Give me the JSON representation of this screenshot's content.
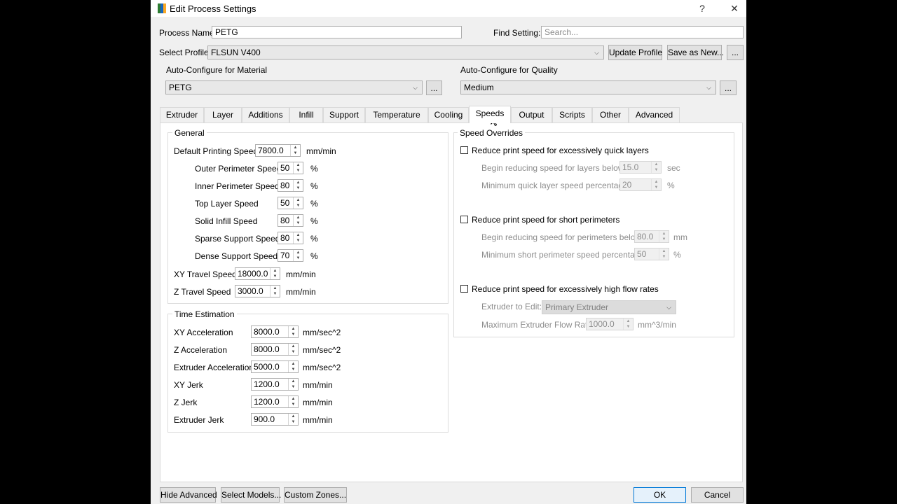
{
  "window": {
    "title": "Edit Process Settings",
    "help": "?",
    "close": "✕"
  },
  "top": {
    "process_name_label": "Process Name",
    "process_name_value": "PETG",
    "find_setting_label": "Find Setting:",
    "find_setting_placeholder": "Search...",
    "select_profile_label": "Select Profile",
    "select_profile_value": "FLSUN V400",
    "update_profile": "Update Profile",
    "save_as_new": "Save as New...",
    "more": "..."
  },
  "autoconfig": {
    "material_label": "Auto-Configure for Material",
    "material_value": "PETG",
    "quality_label": "Auto-Configure for Quality",
    "quality_value": "Medium",
    "more": "..."
  },
  "tabs": [
    "Extruder",
    "Layer",
    "Additions",
    "Infill",
    "Support",
    "Temperature",
    "Cooling",
    "Speeds",
    "Output",
    "Scripts",
    "Other",
    "Advanced"
  ],
  "active_tab": "Speeds",
  "general": {
    "title": "General",
    "default_label": "Default Printing Speed",
    "default_value": "7800.0",
    "default_unit": "mm/min",
    "outer_label": "Outer Perimeter Speed",
    "outer_value": "50",
    "inner_label": "Inner Perimeter Speed",
    "inner_value": "80",
    "top_label": "Top Layer Speed",
    "top_value": "50",
    "solid_label": "Solid Infill Speed",
    "solid_value": "80",
    "sparse_label": "Sparse Support Speed",
    "sparse_value": "80",
    "dense_label": "Dense Support Speed",
    "dense_value": "70",
    "pct": "%",
    "xy_travel_label": "XY Travel Speed",
    "xy_travel_value": "18000.0",
    "z_travel_label": "Z Travel Speed",
    "z_travel_value": "3000.0",
    "mmmin": "mm/min"
  },
  "time": {
    "title": "Time Estimation",
    "xy_acc_label": "XY Acceleration",
    "xy_acc_value": "8000.0",
    "z_acc_label": "Z Acceleration",
    "z_acc_value": "8000.0",
    "ext_acc_label": "Extruder Acceleration",
    "ext_acc_value": "5000.0",
    "acc_unit": "mm/sec^2",
    "xy_jerk_label": "XY Jerk",
    "xy_jerk_value": "1200.0",
    "z_jerk_label": "Z Jerk",
    "z_jerk_value": "1200.0",
    "ext_jerk_label": "Extruder Jerk",
    "ext_jerk_value": "900.0",
    "jerk_unit": "mm/min"
  },
  "overrides": {
    "title": "Speed Overrides",
    "quick_layers_label": "Reduce print speed for excessively quick layers",
    "quick_begin_label": "Begin reducing speed for layers below",
    "quick_begin_value": "15.0",
    "quick_begin_unit": "sec",
    "quick_min_label": "Minimum quick layer speed percentage",
    "quick_min_value": "20",
    "quick_min_unit": "%",
    "short_label": "Reduce print speed for short perimeters",
    "short_begin_label": "Begin reducing speed for perimeters below",
    "short_begin_value": "80.0",
    "short_begin_unit": "mm",
    "short_min_label": "Minimum short perimeter speed percentage",
    "short_min_value": "50",
    "short_min_unit": "%",
    "flow_label": "Reduce print speed for excessively high flow rates",
    "extruder_edit_label": "Extruder to Edit:",
    "extruder_edit_value": "Primary Extruder",
    "max_flow_label": "Maximum Extruder Flow Rate",
    "max_flow_value": "1000.0",
    "max_flow_unit": "mm^3/min"
  },
  "bottom": {
    "hide_advanced": "Hide Advanced",
    "select_models": "Select Models...",
    "custom_zones": "Custom Zones...",
    "ok": "OK",
    "cancel": "Cancel"
  },
  "colors": {
    "dialog_bg": "#f0f0f0",
    "accent": "#0078d7",
    "disabled_text": "#8c8c8c"
  }
}
